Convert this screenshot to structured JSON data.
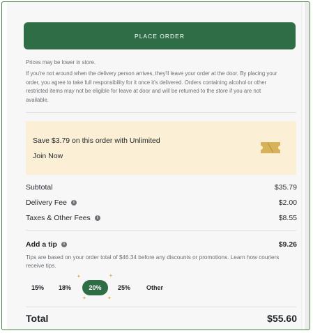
{
  "checkout": {
    "place_order_label": "PLACE ORDER",
    "prices_note": "Prices may be lower in store.",
    "leave_note": "If you're not around when the delivery person arrives, they'll leave your order at the door. By placing your order, you agree to take full responsibility for it once it's delivered. Orders containing alcohol or other restricted items may not be eligible for leave at door and will be returned to the store if you are not available."
  },
  "promo": {
    "title": "Save $3.79 on this order with Unlimited",
    "link": "Join Now",
    "icon": "ticket-icon",
    "background": "#fbf0d6",
    "icon_color": "#d6b35a"
  },
  "summary": {
    "subtotal_label": "Subtotal",
    "subtotal_value": "$35.79",
    "delivery_label": "Delivery Fee",
    "delivery_value": "$2.00",
    "taxes_label": "Taxes & Other Fees",
    "taxes_value": "$8.55",
    "tip_label": "Add a tip",
    "tip_value": "$9.26",
    "tip_desc": "Tips are based on your order total of $46.34 before any discounts or promotions. Learn how couriers receive tips.",
    "total_label": "Total",
    "total_value": "$55.60"
  },
  "tips": {
    "options": [
      "15%",
      "18%",
      "20%",
      "25%",
      "Other"
    ],
    "selected": "20%"
  },
  "colors": {
    "accent": "#2f6d46",
    "frame": "#3f7d3a"
  }
}
